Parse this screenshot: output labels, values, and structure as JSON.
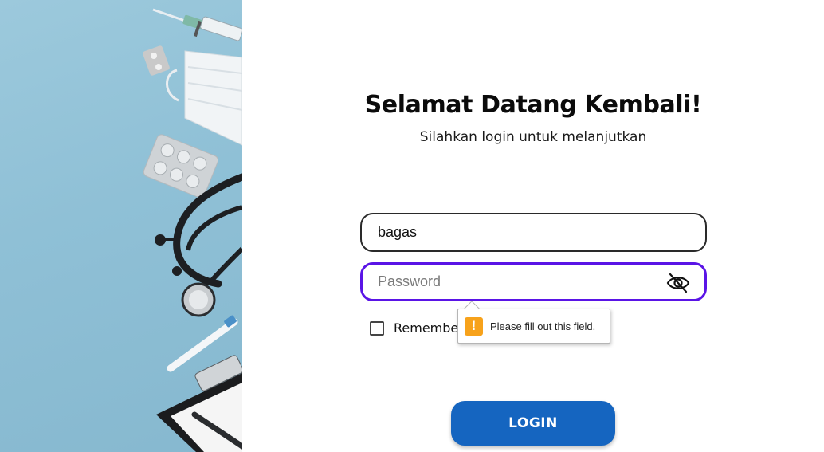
{
  "colors": {
    "accent": "#5a14e6",
    "button": "#1565c0",
    "warning": "#f7a21b",
    "hero_bg": "#8fc0d6"
  },
  "hero": {
    "image": "medical-supplies-illustration"
  },
  "header": {
    "title": "Selamat Datang Kembali!",
    "subtitle": "Silahkan login untuk melanjutkan"
  },
  "form": {
    "username": {
      "value": "bagas",
      "placeholder": ""
    },
    "password": {
      "value": "",
      "placeholder": "Password",
      "toggle_icon": "eye-slash-icon"
    },
    "remember_label": "Remember",
    "validation_message": "Please fill out this field.",
    "validation_icon": "warning-icon",
    "login_label": "LOGIN"
  }
}
